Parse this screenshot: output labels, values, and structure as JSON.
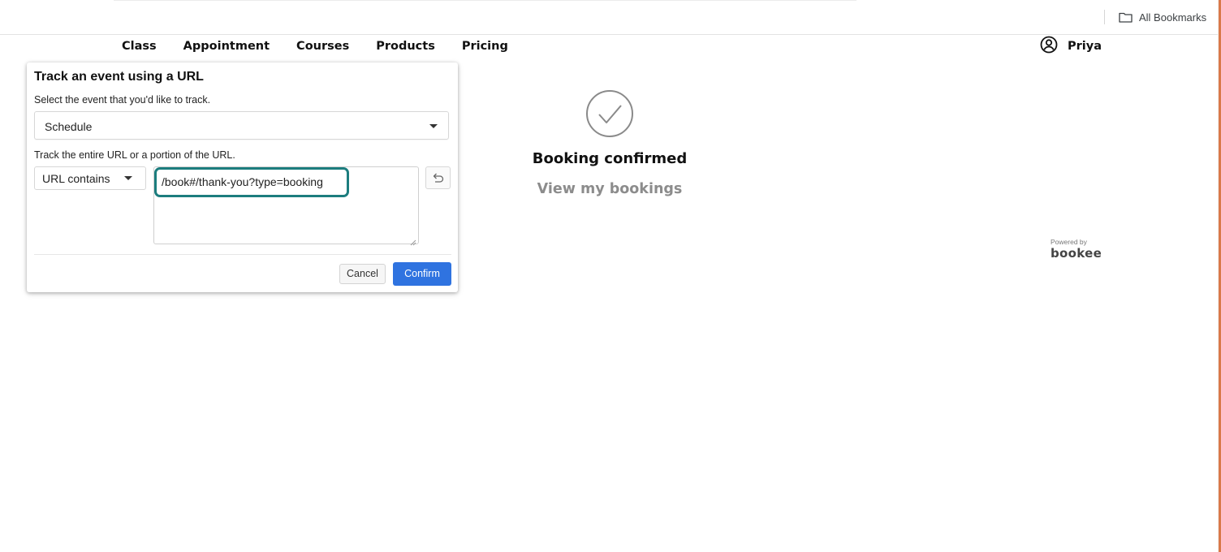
{
  "browser": {
    "all_bookmarks_label": "All Bookmarks"
  },
  "site_nav": {
    "items": [
      "Class",
      "Appointment",
      "Courses",
      "Products",
      "Pricing"
    ],
    "user_name": "Priya"
  },
  "confirmation": {
    "title": "Booking confirmed",
    "view_link": "View my bookings",
    "powered_by": "Powered by",
    "brand": "bookee"
  },
  "dialog": {
    "title": "Track an event using a URL",
    "event_label": "Select the event that you'd like to track.",
    "event_value": "Schedule",
    "url_label": "Track the entire URL or a portion of the URL.",
    "match_value": "URL contains",
    "url_value": "/book#/thank-you?type=booking",
    "cancel_label": "Cancel",
    "confirm_label": "Confirm"
  },
  "colors": {
    "highlight": "#1c7d7e",
    "confirm_button": "#2f73e0",
    "edge_accent": "#d9794a"
  }
}
